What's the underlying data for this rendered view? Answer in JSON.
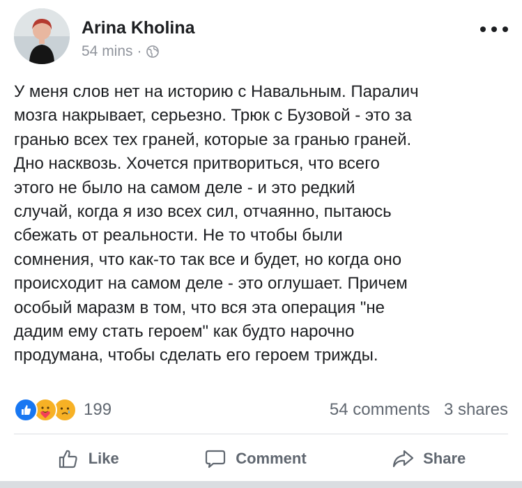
{
  "post": {
    "author": "Arina Kholina",
    "time": "54 mins",
    "separator": "·",
    "privacy_icon": "globe-icon",
    "menu_icon": "more-options-icon",
    "text": "У меня слов нет на историю с Навальным. Паралич\nмозга накрывает, серьезно. Трюк с Бузовой - это за\nгранью всех тех граней, которые за гранью граней.\nДно насквозь. Хочется притвориться, что всего\nэтого не было на самом деле - и это редкий\nслучай, когда я изо всех сил, отчаянно, пытаюсь\nсбежать от реальности. Не то чтобы были\nсомнения, что как-то так все и будет, но когда оно\nпроисходит на самом деле - это оглушает. Причем\nособый маразм в том, что вся эта операция \"не\nдадим ему стать героем\" как будто нарочно\nпродумана, чтобы сделать его героем трижды.",
    "reactions": {
      "icons": [
        "like-reaction-icon",
        "care-reaction-icon",
        "sad-reaction-icon"
      ],
      "count": "199"
    },
    "comments": "54 comments",
    "shares": "3 shares"
  },
  "actions": {
    "like": "Like",
    "comment": "Comment",
    "share": "Share"
  },
  "colors": {
    "text": "#1c1e21",
    "secondary": "#606770",
    "meta": "#90949c",
    "like_blue": "#1877f2",
    "emoji_yellow": "#f7b125"
  }
}
